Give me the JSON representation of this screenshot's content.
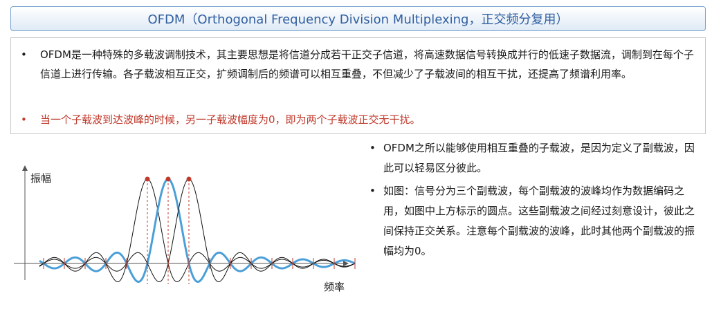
{
  "title": "OFDM（Orthogonal Frequency Division Multiplexing，正交频分复用）",
  "box_bullets": [
    {
      "text": "OFDM是一种特殊的多载波调制技术，其主要思想是将信道分成若干正交子信道，将高速数据信号转换成并行的低速子数据流，调制到在每个子信道上进行传输。各子载波相互正交，扩频调制后的频谱可以相互重叠，不但减少了子载波间的相互干扰，还提高了频谱利用率。",
      "color": "#1a1a1a"
    },
    {
      "text": "当一个子载波到达波峰的时候，另一子载波幅度为0，即为两个子载波正交无干扰。",
      "color": "#c0392b"
    }
  ],
  "right_bullets": [
    "OFDM之所以能够使用相互重叠的子载波，是因为定义了副载波，因此可以轻易区分彼此。",
    "如图：信号分为三个副载波，每个副载波的波峰均作为数据编码之用，如图中上方标示的圆点。这些副载波之间经过刻意设计，彼此之间保持正交关系。注意每个副载波的波峰，此时其他两个副载波的振幅均为0。"
  ],
  "diagram": {
    "y_label": "振幅",
    "x_label": "频率",
    "subcarriers": [
      {
        "center": -1,
        "color": "#111111"
      },
      {
        "center": 0,
        "color": "#4a9fd8"
      },
      {
        "center": 1,
        "color": "#111111"
      }
    ],
    "x_range": [
      -6.2,
      9
    ],
    "colors": {
      "peak_marker": "#c0392b",
      "tick": "#c0392b",
      "highlight": "#4a9fd8"
    }
  }
}
